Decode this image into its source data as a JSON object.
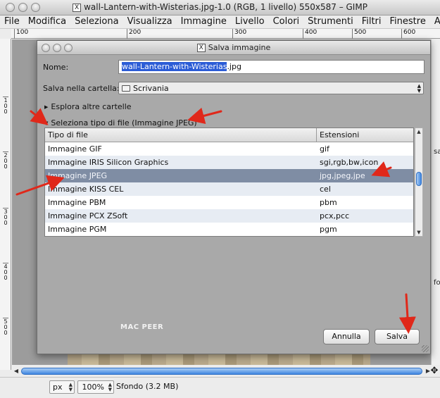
{
  "window": {
    "title": "wall-Lantern-with-Wisterias.jpg-1.0 (RGB, 1 livello) 550x587 – GIMP",
    "title_icon": "X"
  },
  "menubar": [
    "File",
    "Modifica",
    "Seleziona",
    "Visualizza",
    "Immagine",
    "Livello",
    "Colori",
    "Strumenti",
    "Filtri",
    "Finestre",
    "Aiuto"
  ],
  "ruler_top": [
    "100",
    "200",
    "300",
    "400",
    "500",
    "600"
  ],
  "ruler_left": [
    "1\n0\n0",
    "2\n0\n0",
    "3\n0\n0",
    "4\n0\n0",
    "5\n0\n0"
  ],
  "right_fragments": [
    "sa",
    "fo"
  ],
  "dialog": {
    "title": "Salva immagine",
    "title_icon": "X",
    "name_label": "Nome:",
    "filename_selected": "wall-Lantern-with-Wisterias",
    "filename_ext": ".jpg",
    "folder_label": "Salva nella cartella:",
    "folder_value": "Scrivania",
    "browse_expander": "Esplora altre cartelle",
    "filetype_expander": "Seleziona tipo di file (Immagine JPEG)",
    "table": {
      "columns": [
        "Tipo di file",
        "Estensioni"
      ],
      "rows": [
        {
          "type": "Immagine GIF",
          "ext": "gif"
        },
        {
          "type": "Immagine IRIS Silicon Graphics",
          "ext": "sgi,rgb,bw,icon"
        },
        {
          "type": "Immagine JPEG",
          "ext": "jpg,jpeg,jpe"
        },
        {
          "type": "Immagine KISS CEL",
          "ext": "cel"
        },
        {
          "type": "Immagine PBM",
          "ext": "pbm"
        },
        {
          "type": "Immagine PCX ZSoft",
          "ext": "pcx,pcc"
        },
        {
          "type": "Immagine PGM",
          "ext": "pgm"
        }
      ],
      "selected_index": 2
    },
    "watermark": "MAC PEER",
    "cancel_label": "Annulla",
    "save_label": "Salva"
  },
  "statusbar": {
    "unit": "px",
    "zoom": "100%",
    "layer_info": "Sfondo (3.2 MB)"
  },
  "colors": {
    "selection_blue": "#2b5cd6",
    "selected_row": "#7f8da4",
    "alt_row": "#e7ecf3",
    "scroll_blue": "#3f86e0",
    "annotation_red": "#e0281a",
    "dialog_bg": "#a9a9a9"
  }
}
